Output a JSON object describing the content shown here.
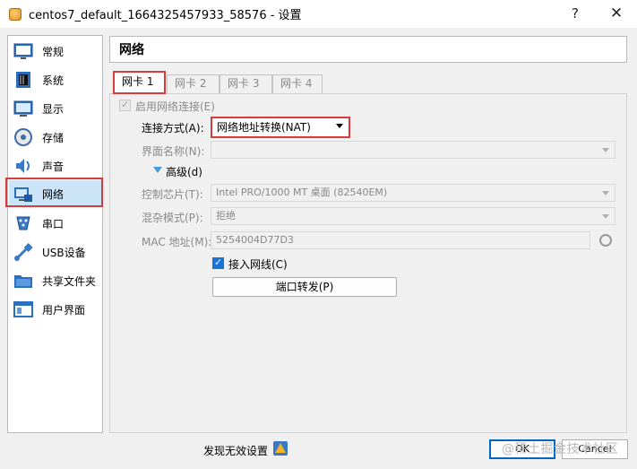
{
  "window": {
    "title": "centos7_default_1664325457933_58576 - 设置",
    "help_glyph": "?",
    "close_glyph": "✕"
  },
  "sidebar": {
    "items": [
      {
        "label": "常规",
        "icon": "general-icon"
      },
      {
        "label": "系统",
        "icon": "system-icon"
      },
      {
        "label": "显示",
        "icon": "display-icon"
      },
      {
        "label": "存储",
        "icon": "storage-icon"
      },
      {
        "label": "声音",
        "icon": "audio-icon"
      },
      {
        "label": "网络",
        "icon": "network-icon",
        "selected": true
      },
      {
        "label": "串口",
        "icon": "serial-port-icon"
      },
      {
        "label": "USB设备",
        "icon": "usb-icon"
      },
      {
        "label": "共享文件夹",
        "icon": "shared-folder-icon"
      },
      {
        "label": "用户界面",
        "icon": "user-interface-icon"
      }
    ]
  },
  "header": {
    "title": "网络"
  },
  "tabs": [
    {
      "label": "网卡 1",
      "active": true
    },
    {
      "label": "网卡 2"
    },
    {
      "label": "网卡 3"
    },
    {
      "label": "网卡 4"
    }
  ],
  "adapter": {
    "enable_label": "启用网络连接(E)",
    "enable_checked": true,
    "attached_to_label": "连接方式(A):",
    "attached_to_value": "网络地址转换(NAT)",
    "name_label": "界面名称(N):",
    "name_value": "",
    "advanced_label": "高级(d)",
    "adapter_type_label": "控制芯片(T):",
    "adapter_type_value": "Intel PRO/1000 MT 桌面 (82540EM)",
    "promiscuous_label": "混杂模式(P):",
    "promiscuous_value": "拒绝",
    "mac_label": "MAC 地址(M):",
    "mac_value": "5254004D77D3",
    "cable_label": "接入网线(C)",
    "cable_checked": true,
    "port_forward_label": "端口转发(P)"
  },
  "footer": {
    "invalid_settings_label": "发现无效设置",
    "ok_label": "OK",
    "cancel_label": "Cancel",
    "watermark": "@稀土掘金技术社区"
  }
}
